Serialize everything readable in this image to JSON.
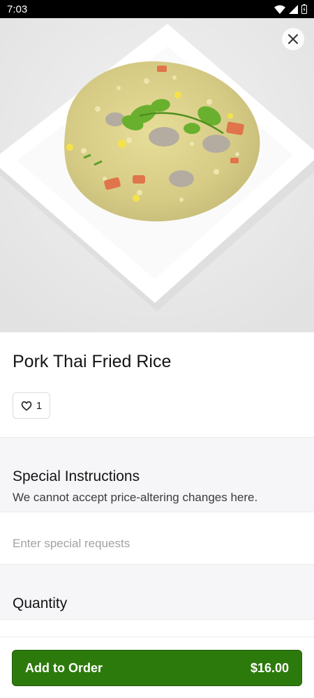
{
  "status_bar": {
    "time": "7:03"
  },
  "item": {
    "name": "Pork Thai Fried Rice",
    "like_count": "1"
  },
  "special_instructions": {
    "title": "Special Instructions",
    "subtitle": "We cannot accept price-altering changes here.",
    "placeholder": "Enter special requests"
  },
  "quantity": {
    "title": "Quantity"
  },
  "order_button": {
    "label": "Add to Order",
    "price": "$16.00"
  },
  "colors": {
    "accent": "#2d7a0c",
    "section_background": "#f6f5f8"
  },
  "icons": [
    "wifi-icon",
    "signal-icon",
    "battery-icon",
    "close-icon",
    "heart-icon"
  ]
}
